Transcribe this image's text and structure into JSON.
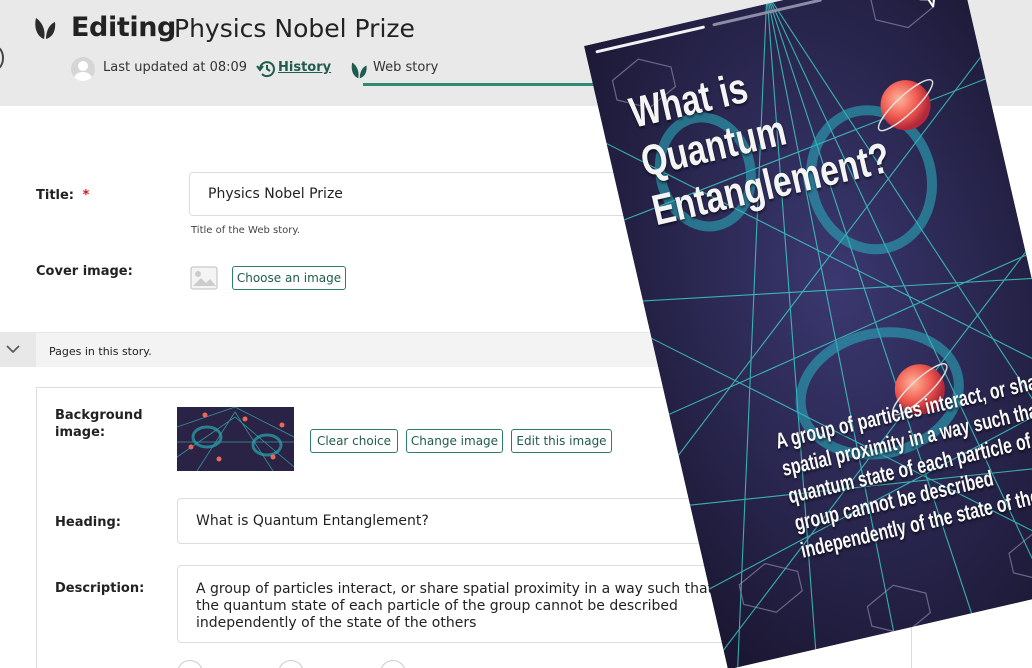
{
  "header": {
    "editing_label": "Editing",
    "title": "Physics Nobel Prize",
    "updated": "Last updated at 08:09",
    "history_link": "History",
    "web_story_tab": "Web story",
    "accent": "#2e8b6f"
  },
  "form": {
    "title_label": "Title:",
    "required_mark": "*",
    "title_value": "Physics Nobel Prize",
    "title_help": "Title of the Web story.",
    "cover_label": "Cover image:",
    "choose_image_button": "Choose an image",
    "pages_label": "Pages in this story."
  },
  "page1": {
    "background_label": "Background image:",
    "clear_button": "Clear choice",
    "change_button": "Change image",
    "edit_button": "Edit this image",
    "heading_label": "Heading:",
    "heading_value": "What is Quantum Entanglement?",
    "description_label": "Description:",
    "description_value": "A group of particles interact, or share spatial proximity in a way such that the quantum state of each particle of the group cannot be described independently of the state of the others"
  },
  "story_preview": {
    "heading": "What is Quantum Entanglement?",
    "body": "A group of particles interact, or share spatial proximity in a way such that the quantum state of each particle of the group cannot be described independently of the state of the others",
    "icons": [
      "share-icon"
    ]
  }
}
